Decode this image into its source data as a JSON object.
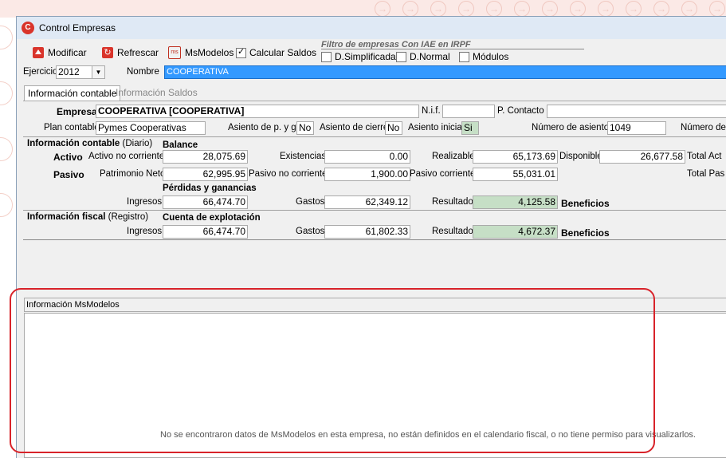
{
  "window": {
    "title": "Control Empresas"
  },
  "toolbar": {
    "modificar": "Modificar",
    "refrescar": "Refrescar",
    "msmodelos": "MsModelos",
    "calcular_saldos": "Calcular Saldos",
    "calcular_saldos_checked": true
  },
  "filter": {
    "title": "Filtro de empresas Con IAE en IRPF",
    "simplificada": "D.Simplificada",
    "normal": "D.Normal",
    "modulos": "Módulos"
  },
  "ejercicio": {
    "label": "Ejercicio",
    "value": "2012"
  },
  "nombre": {
    "label": "Nombre",
    "value": "COOPERATIVA"
  },
  "tabs": [
    {
      "label": "Información contable",
      "active": true
    },
    {
      "label": "Información Saldos",
      "active": false
    }
  ],
  "empresa": {
    "label": "Empresa",
    "value": "COOPERATIVA [COOPERATIVA]",
    "nif_label": "N.i.f.",
    "nif_value": "",
    "contacto_label": "P. Contacto",
    "contacto_value": "",
    "plan_label": "Plan contable",
    "plan_value": "Pymes Cooperativas",
    "pyg_label": "Asiento de p. y g.",
    "pyg_value": "No",
    "cierre_label": "Asiento de cierre",
    "cierre_value": "No",
    "inicial_label": "Asiento inicial",
    "inicial_value": "Si",
    "num_asientos_label": "Número de asientos",
    "num_asientos_value": "1049",
    "numero_de_label": "Número de"
  },
  "contable": {
    "title": "Información contable",
    "subtitle": "(Diario)",
    "balance_label": "Balance",
    "activo_label": "Activo",
    "activo_no_corriente_label": "Activo no corriente",
    "activo_no_corriente": "28,075.69",
    "existencias_label": "Existencias",
    "existencias": "0.00",
    "realizable_label": "Realizable",
    "realizable": "65,173.69",
    "disponible_label": "Disponible",
    "disponible": "26,677.58",
    "total_activo_label": "Total Act",
    "pasivo_label": "Pasivo",
    "patrimonio_neto_label": "Patrimonio Neto",
    "patrimonio_neto": "62,995.95",
    "pasivo_no_corriente_label": "Pasivo no corriente",
    "pasivo_no_corriente": "1,900.00",
    "pasivo_corriente_label": "Pasivo corriente",
    "pasivo_corriente": "55,031.01",
    "total_pasivo_label": "Total Pas",
    "pyg_title": "Pérdidas y ganancias",
    "ingresos_label": "Ingresos",
    "ingresos": "66,474.70",
    "gastos_label": "Gastos",
    "gastos": "62,349.12",
    "resultado_label": "Resultado",
    "resultado": "4,125.58",
    "beneficios": "Beneficios"
  },
  "fiscal": {
    "title": "Información fiscal",
    "subtitle": "(Registro)",
    "cuenta_title": "Cuenta de explotación",
    "ingresos_label": "Ingresos",
    "ingresos": "66,474.70",
    "gastos_label": "Gastos",
    "gastos": "61,802.33",
    "resultado_label": "Resultado",
    "resultado": "4,672.37",
    "beneficios": "Beneficios"
  },
  "msmodelos": {
    "header": "Información MsModelos",
    "message": "No se encontraron datos de MsModelos en esta empresa, no están definidos en el calendario fiscal, o no tiene permiso para visualizarlos."
  },
  "colors": {
    "accent": "#3399ff",
    "highlight": "#d8232a",
    "result_bg": "#c6dfc6"
  }
}
